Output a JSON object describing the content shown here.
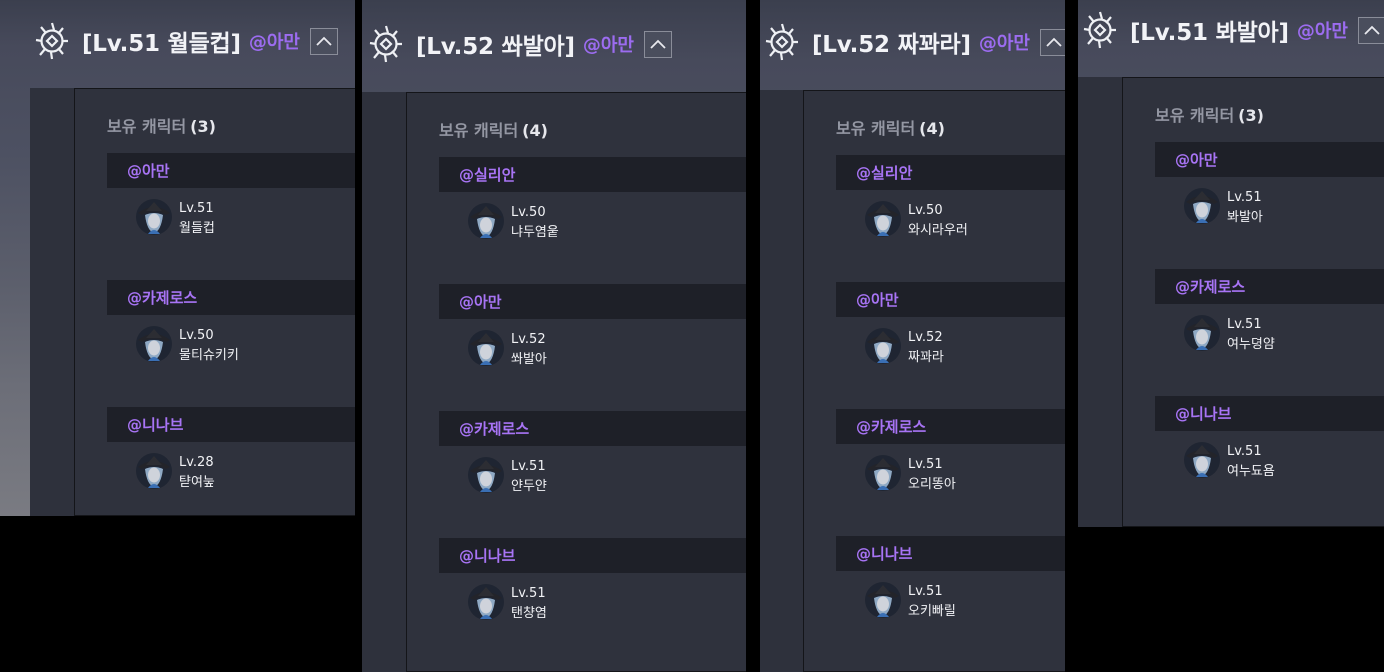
{
  "section_label": "보유 캐릭터",
  "icons": {
    "emblem": "guild-emblem-icon",
    "collapse": "chevron-up-icon",
    "portrait": "character-portrait-icon"
  },
  "colors": {
    "family_name": "#a874f5",
    "panel": "#2f323d",
    "family_bar": "#1e2028"
  },
  "windows": [
    {
      "title": "[Lv.51 월들컵]",
      "family": "@아만",
      "count": "(3)",
      "groups": [
        {
          "family": "@아만",
          "level": "Lv.51",
          "name": "월들컵"
        },
        {
          "family": "@카제로스",
          "level": "Lv.50",
          "name": "물티슈키키"
        },
        {
          "family": "@니나브",
          "level": "Lv.28",
          "name": "탿여눞"
        }
      ]
    },
    {
      "title": "[Lv.52 쏴발아]",
      "family": "@아만",
      "count": "(4)",
      "groups": [
        {
          "family": "@실리안",
          "level": "Lv.50",
          "name": "냐두염웉"
        },
        {
          "family": "@아만",
          "level": "Lv.52",
          "name": "쏴발아"
        },
        {
          "family": "@카제로스",
          "level": "Lv.51",
          "name": "얀두얀"
        },
        {
          "family": "@니나브",
          "level": "Lv.51",
          "name": "탠챵염"
        }
      ]
    },
    {
      "title": "[Lv.52 짜꽈라]",
      "family": "@아만",
      "count": "(4)",
      "groups": [
        {
          "family": "@실리안",
          "level": "Lv.50",
          "name": "와시라우러"
        },
        {
          "family": "@아만",
          "level": "Lv.52",
          "name": "짜꽈라"
        },
        {
          "family": "@카제로스",
          "level": "Lv.51",
          "name": "오리똥아"
        },
        {
          "family": "@니나브",
          "level": "Lv.51",
          "name": "오키빠릴"
        }
      ]
    },
    {
      "title": "[Lv.51 봐발아]",
      "family": "@아만",
      "count": "(3)",
      "groups": [
        {
          "family": "@아만",
          "level": "Lv.51",
          "name": "봐발아"
        },
        {
          "family": "@카제로스",
          "level": "Lv.51",
          "name": "여누뎡얌"
        },
        {
          "family": "@니나브",
          "level": "Lv.51",
          "name": "여누됴욤"
        }
      ]
    }
  ]
}
